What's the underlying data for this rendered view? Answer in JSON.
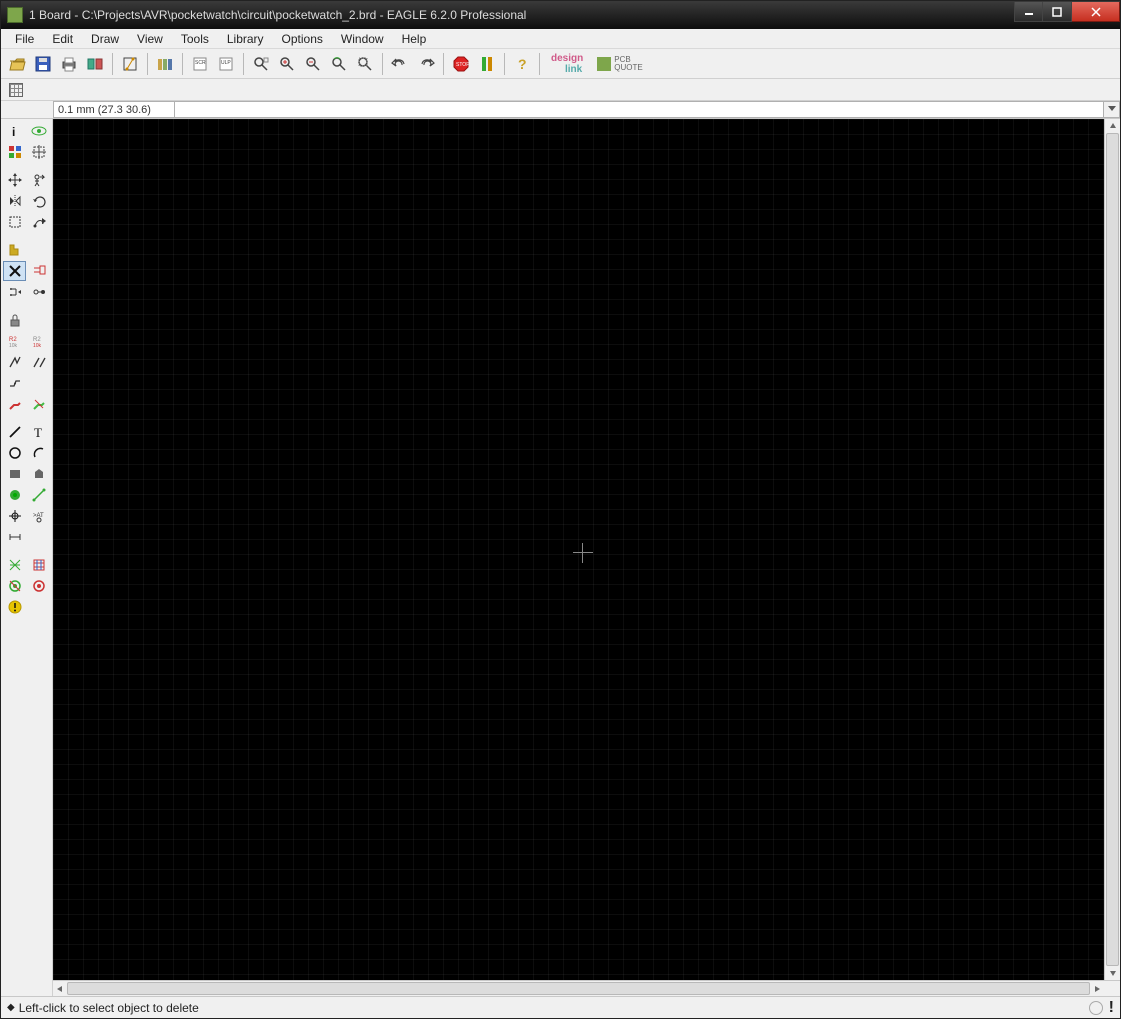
{
  "window": {
    "title": "1 Board - C:\\Projects\\AVR\\pocketwatch\\circuit\\pocketwatch_2.brd - EAGLE 6.2.0 Professional"
  },
  "menu": {
    "items": [
      "File",
      "Edit",
      "Draw",
      "View",
      "Tools",
      "Library",
      "Options",
      "Window",
      "Help"
    ]
  },
  "toolbar": {
    "design_link": "design link",
    "pcb_quote": "PCB QUOTE"
  },
  "coord": {
    "value": "0.1 mm (27.3 30.6)",
    "command": ""
  },
  "status": {
    "hint": "Left-click to select object to delete",
    "indicator": "!"
  }
}
